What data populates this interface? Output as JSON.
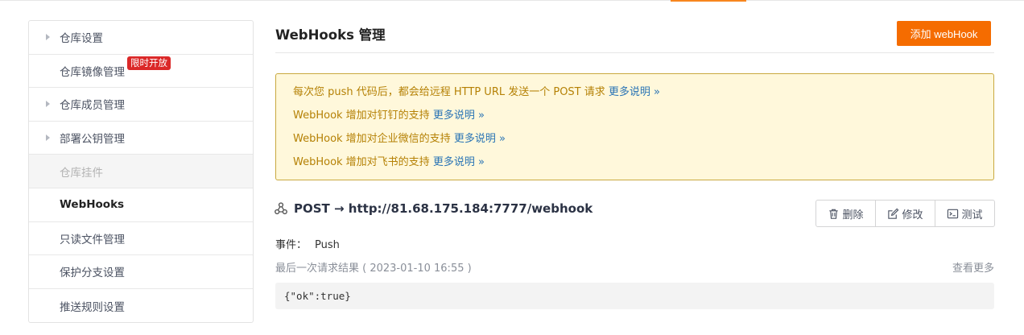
{
  "sidebar": {
    "items": [
      {
        "label": "仓库设置",
        "caret": true,
        "state": "normal"
      },
      {
        "label": "仓库镜像管理",
        "caret": false,
        "state": "normal",
        "badge": "限时开放"
      },
      {
        "label": "仓库成员管理",
        "caret": true,
        "state": "normal"
      },
      {
        "label": "部署公钥管理",
        "caret": true,
        "state": "normal"
      },
      {
        "label": "仓库挂件",
        "caret": false,
        "state": "disabled"
      },
      {
        "label": "WebHooks",
        "caret": false,
        "state": "active"
      },
      {
        "label": "只读文件管理",
        "caret": false,
        "state": "normal"
      },
      {
        "label": "保护分支设置",
        "caret": false,
        "state": "normal"
      },
      {
        "label": "推送规则设置",
        "caret": false,
        "state": "normal"
      }
    ]
  },
  "main": {
    "title": "WebHooks 管理",
    "add_button": "添加 webHook",
    "notices": [
      {
        "text": "每次您 push 代码后，都会给远程 HTTP URL 发送一个 POST 请求 ",
        "more": "更多说明 »"
      },
      {
        "text": "WebHook 增加对钉钉的支持 ",
        "more": "更多说明 »"
      },
      {
        "text": "WebHook 增加对企业微信的支持 ",
        "more": "更多说明 »"
      },
      {
        "text": "WebHook 增加对飞书的支持 ",
        "more": "更多说明 »"
      }
    ],
    "hook": {
      "icon": "webhook-icon",
      "title": "POST → http://81.68.175.184:7777/webhook",
      "actions": {
        "delete": "删除",
        "edit": "修改",
        "test": "测试"
      },
      "events_label": "事件：",
      "events_value": "Push",
      "last_request": "最后一次请求结果 ( 2023-01-10 16:55 )",
      "see_more": "查看更多",
      "response": "{\"ok\":true}"
    }
  },
  "colors": {
    "accent": "#f56c00",
    "badge": "#db2828",
    "notice_bg": "#fff8db",
    "notice_text": "#b58105",
    "link": "#2a74b5"
  }
}
